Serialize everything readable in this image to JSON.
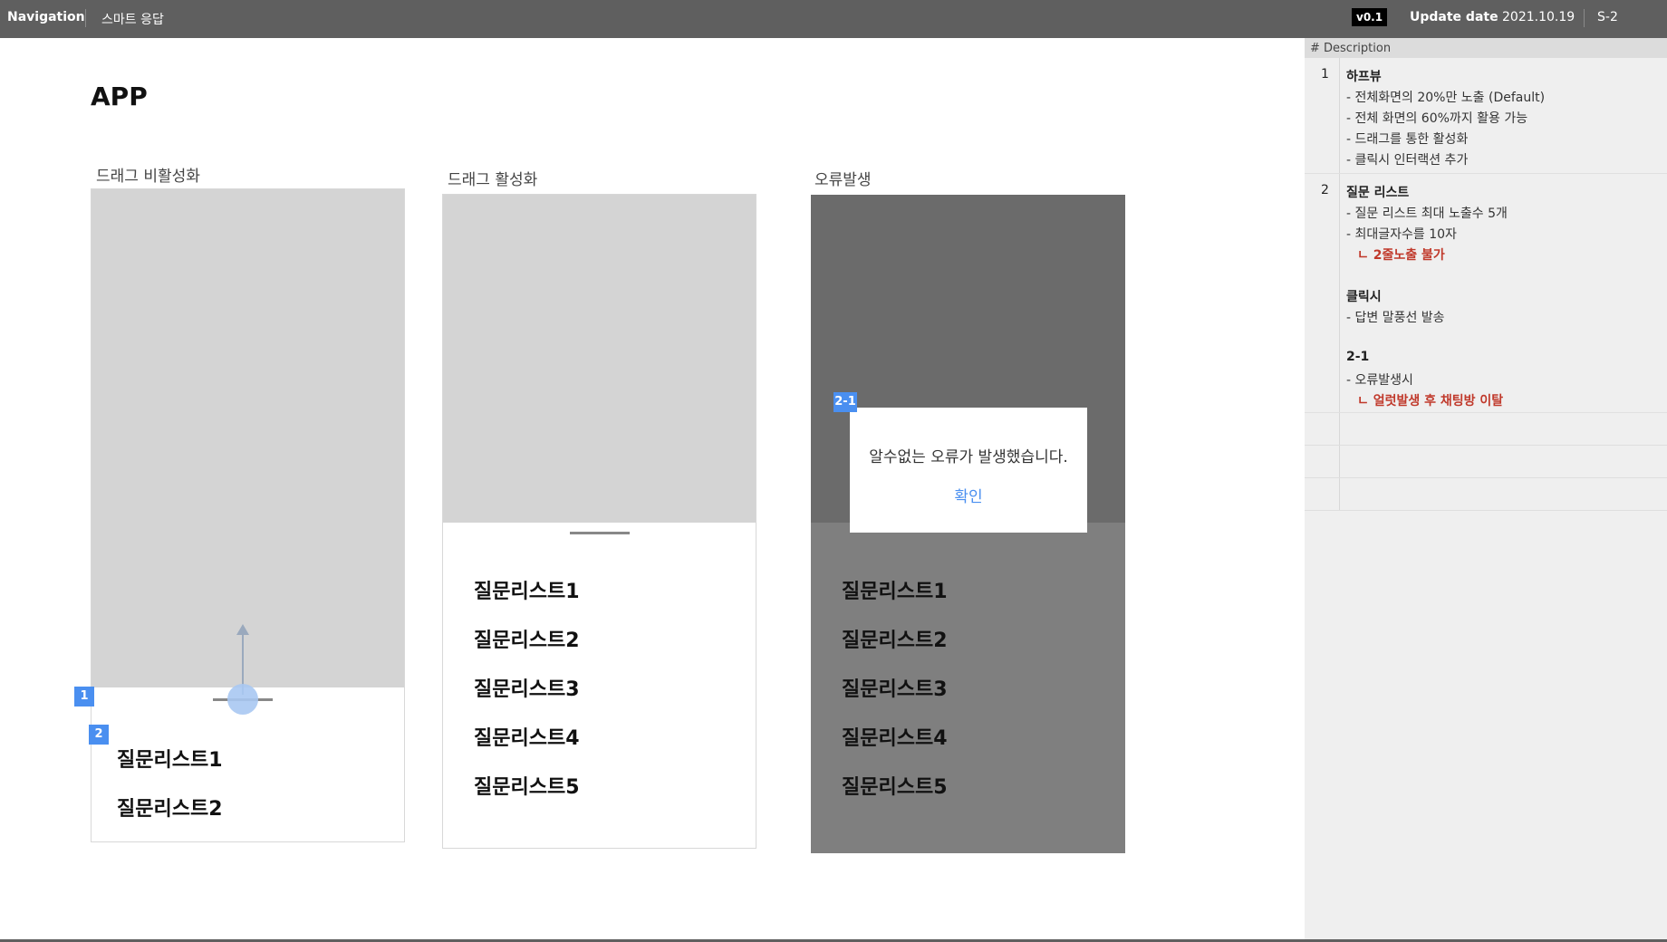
{
  "topbar": {
    "nav_label": "Navigation",
    "breadcrumb": "스마트 응답",
    "version": "v0.1",
    "update_label": "Update date",
    "update_value": "2021.10.19",
    "screen_code": "S-2"
  },
  "main": {
    "title": "APP",
    "columns": [
      {
        "label": "드래그 비활성화",
        "questions": [
          "질문리스트1",
          "질문리스트2"
        ]
      },
      {
        "label": "드래그 활성화",
        "questions": [
          "질문리스트1",
          "질문리스트2",
          "질문리스트3",
          "질문리스트4",
          "질문리스트5"
        ]
      },
      {
        "label": "오류발생",
        "questions": [
          "질문리스트1",
          "질문리스트2",
          "질문리스트3",
          "질문리스트4",
          "질문리스트5"
        ]
      }
    ],
    "badges": {
      "b1": "1",
      "b2": "2",
      "b21": "2-1"
    },
    "dialog": {
      "message": "알수없는 오류가 발생했습니다.",
      "confirm": "확인"
    }
  },
  "description": {
    "header": "# Description",
    "sections": [
      {
        "num": "1",
        "lines": [
          {
            "text": "하프뷰",
            "style": "bold"
          },
          {
            "text": "- 전체화면의 20%만 노출 (Default)",
            "style": "normal"
          },
          {
            "text": "- 전체 화면의 60%까지 활용 가능",
            "style": "normal"
          },
          {
            "text": "- 드래그를 통한 활성화",
            "style": "normal"
          },
          {
            "text": "- 클릭시 인터랙션 추가",
            "style": "normal"
          }
        ]
      },
      {
        "num": "2",
        "lines": [
          {
            "text": "질문 리스트",
            "style": "bold"
          },
          {
            "text": "- 질문 리스트 최대 노출수 5개",
            "style": "normal"
          },
          {
            "text": "- 최대글자수를 10자",
            "style": "normal"
          },
          {
            "text": "ㄴ 2줄노출 불가",
            "style": "red"
          },
          {
            "text": "",
            "style": "normal"
          },
          {
            "text": "클릭시",
            "style": "bold"
          },
          {
            "text": "- 답변 말풍선 발송",
            "style": "normal"
          },
          {
            "text": "",
            "style": "normal"
          },
          {
            "text": "2-1",
            "style": "bold"
          },
          {
            "text": "- 오류발생시",
            "style": "normal"
          },
          {
            "text": "ㄴ 얼럿발생 후 채팅방 이탈",
            "style": "red"
          }
        ]
      }
    ]
  }
}
